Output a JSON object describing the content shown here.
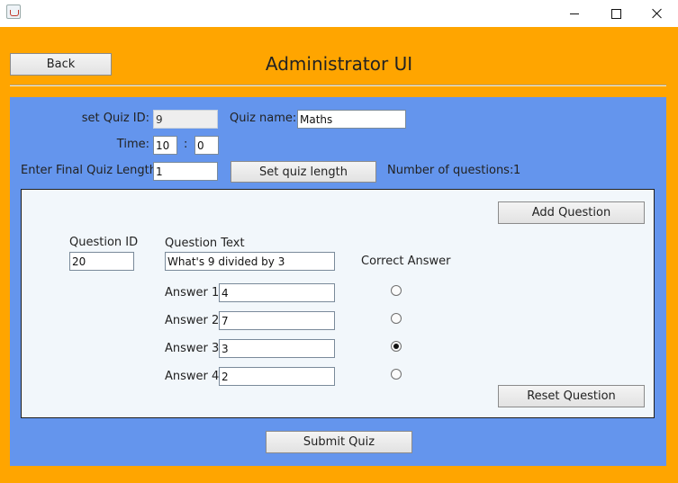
{
  "window": {
    "title": "",
    "controls": {
      "minimize": "minimize-icon",
      "maximize": "maximize-icon",
      "close": "close-icon"
    }
  },
  "colors": {
    "frame_bg": "#ffa500",
    "panel_bg": "#6495ed",
    "question_panel_bg": "#f2f7fb"
  },
  "header": {
    "back_label": "Back",
    "title": "Administrator UI"
  },
  "quiz": {
    "quiz_id_label": "set Quiz ID:",
    "quiz_id_value": "9",
    "quiz_name_label": "Quiz name:",
    "quiz_name_value": "Maths",
    "time_label": "Time:",
    "time_minutes": "10",
    "time_separator": ":",
    "time_seconds": "0",
    "final_length_label": "Enter Final Quiz Length:",
    "final_length_value": "1",
    "set_length_label": "Set quiz length",
    "num_questions_label": "Number of questions:",
    "num_questions_value": "1"
  },
  "question": {
    "add_label": "Add Question",
    "id_label": "Question ID",
    "id_value": "20",
    "text_label": "Question Text",
    "text_value": "What's 9 divided by 3",
    "correct_answer_label": "Correct Answer",
    "answers": [
      {
        "label": "Answer 1",
        "value": "4",
        "correct": false
      },
      {
        "label": "Answer 2",
        "value": "7",
        "correct": false
      },
      {
        "label": "Answer 3",
        "value": "3",
        "correct": true
      },
      {
        "label": "Answer 4",
        "value": "2",
        "correct": false
      }
    ],
    "reset_label": "Reset Question"
  },
  "footer": {
    "submit_label": "Submit Quiz"
  }
}
